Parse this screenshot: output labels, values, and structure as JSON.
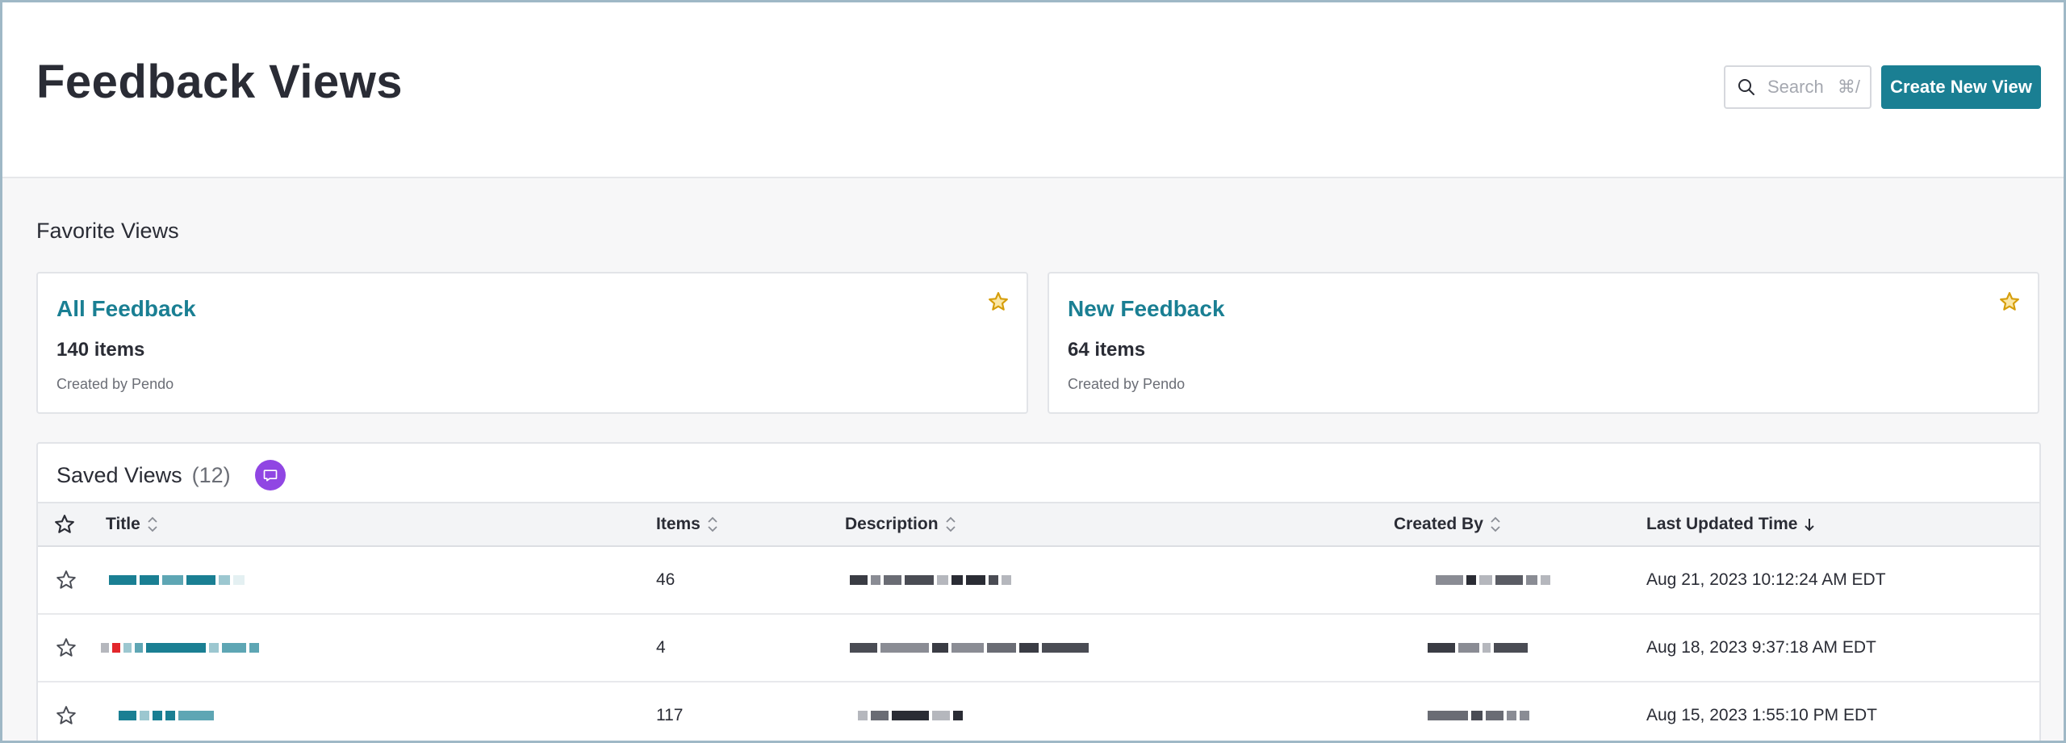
{
  "header": {
    "title": "Feedback Views",
    "search_placeholder": "Search",
    "search_shortcut": "⌘/",
    "create_button_label": "Create New View"
  },
  "favorites": {
    "section_label": "Favorite Views",
    "cards": [
      {
        "title": "All Feedback",
        "count": "140 items",
        "created_by": "Created by Pendo",
        "starred": true
      },
      {
        "title": "New Feedback",
        "count": "64 items",
        "created_by": "Created by Pendo",
        "starred": true
      }
    ]
  },
  "saved_views": {
    "title": "Saved Views",
    "count": "(12)",
    "columns": {
      "title": "Title",
      "items": "Items",
      "description": "Description",
      "created_by": "Created By",
      "last_updated": "Last Updated Time"
    },
    "rows": [
      {
        "items": "46",
        "last_updated": "Aug 21, 2023 10:12:24 AM EDT"
      },
      {
        "items": "4",
        "last_updated": "Aug 18, 2023 9:37:18 AM EDT"
      },
      {
        "items": "117",
        "last_updated": "Aug 15, 2023 1:55:10 PM EDT"
      }
    ]
  },
  "colors": {
    "accent": "#1a7f93",
    "star": "#d69e0b",
    "badge": "#9046e3"
  }
}
